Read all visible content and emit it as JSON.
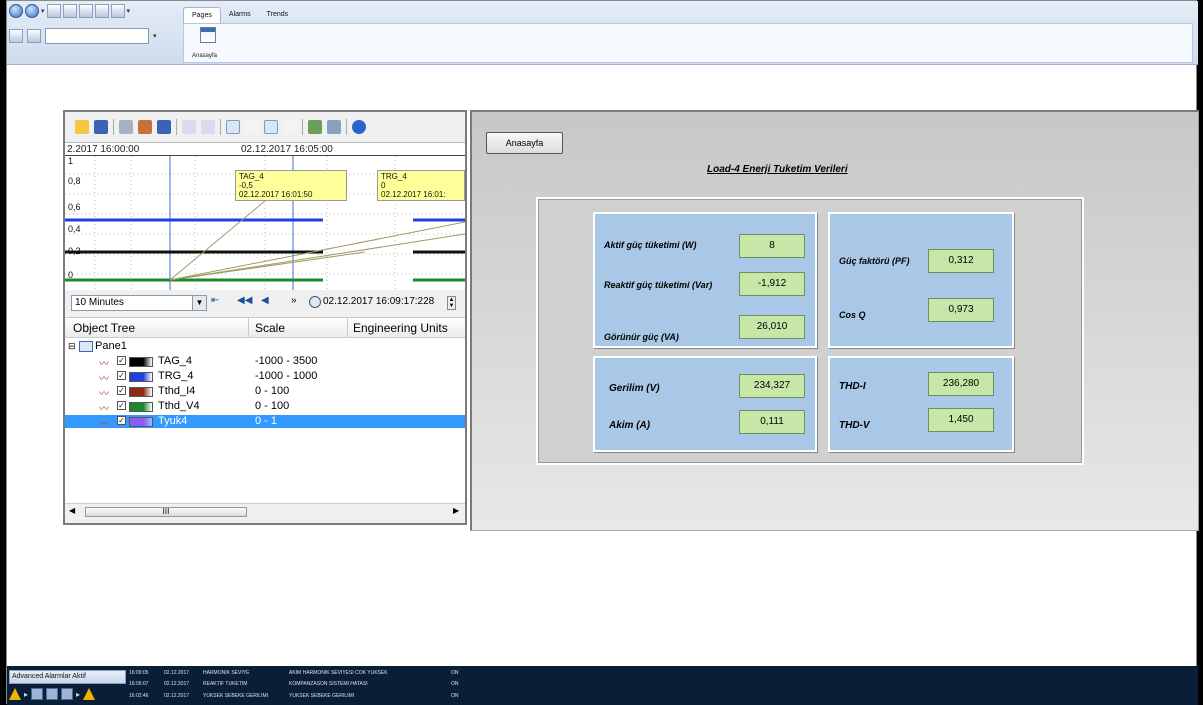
{
  "toolbar": {
    "tabs": [
      {
        "label": "Pages",
        "active": true
      },
      {
        "label": "Alarms",
        "active": false
      },
      {
        "label": "Trends",
        "active": false
      }
    ],
    "ribbon_item": "Anasayfa"
  },
  "trend": {
    "time_left": "2.2017 16:00:00",
    "time_center": "02.12.2017 16:05:00",
    "y_labels": [
      "1",
      "0,8",
      "0,6",
      "0,4",
      "0,2",
      "0"
    ],
    "tooltips": [
      {
        "tag": "TAG_4",
        "value": "-0,5",
        "time": "02.12.2017 16:01:50"
      },
      {
        "tag": "TRG_4",
        "value": "0",
        "time": "02.12.2017 16:01:"
      }
    ],
    "range": "10 Minutes",
    "datetime": "02.12.2017 16:09:17:228",
    "tree_headers": [
      "Object Tree",
      "Scale",
      "Engineering Units"
    ],
    "tree_root": "Pane1",
    "tree_rows": [
      {
        "name": "TAG_4",
        "scale": "-1000 - 3500",
        "color": "#000000",
        "selected": false
      },
      {
        "name": "TRG_4",
        "scale": "-1000 - 1000",
        "color": "#1f3fe0",
        "selected": false
      },
      {
        "name": "Tthd_I4",
        "scale": "0 - 100",
        "color": "#8b2c10",
        "selected": false
      },
      {
        "name": "Tthd_V4",
        "scale": "0 - 100",
        "color": "#1b8a2a",
        "selected": false
      },
      {
        "name": "Tyuk4",
        "scale": "0 - 1",
        "color": "#8a5cf0",
        "selected": true
      }
    ],
    "scroll_thumb": "III"
  },
  "panel": {
    "home_button": "Anasayfa",
    "title": "Load-4 Enerji Tuketim Verileri",
    "aktif_label": "Aktif güç tüketimi (W)",
    "aktif_value": "8",
    "reaktif_label": "Reaktif güç tüketimi (Var)",
    "reaktif_value": "-1,912",
    "gorunur_label": "Görünür güç (VA)",
    "gorunur_value": "26,010",
    "pf_label": "Güç faktörü (PF)",
    "pf_value": "0,312",
    "cos_label": "Cos Q",
    "cos_value": "0,973",
    "gerilim_label": "Gerilim (V)",
    "gerilim_value": "234,327",
    "akim_label": "Akim (A)",
    "akim_value": "0,111",
    "thdi_label": "THD-I",
    "thdi_value": "236,280",
    "thdv_label": "THD-V",
    "thdv_value": "1,450"
  },
  "status": {
    "advanced_label": "Advanced Alarmlar Aktif",
    "alarms": [
      {
        "time": "16:09:05",
        "date": "02.12.2017",
        "source": "HARMONIK SEVIYE",
        "message": "AKIM HARMONIK SEVIYESI COK YUKSEK",
        "state": "ON"
      },
      {
        "time": "16:05:07",
        "date": "02.12.2017",
        "source": "REAKTIF TUKETIM",
        "message": "KOMPANZASON SISTEMI HATASI",
        "state": "ON"
      },
      {
        "time": "16:02:46",
        "date": "02.12.2017",
        "source": "YUKSEK SEBEKE GERILIMI",
        "message": "YUKSEK SEBEKE GERILIMI",
        "state": "ON"
      }
    ]
  },
  "colors": {
    "value_box": "#c6e7a8",
    "info_box": "#a9c7e6",
    "status_bg": "#0b1e38"
  }
}
